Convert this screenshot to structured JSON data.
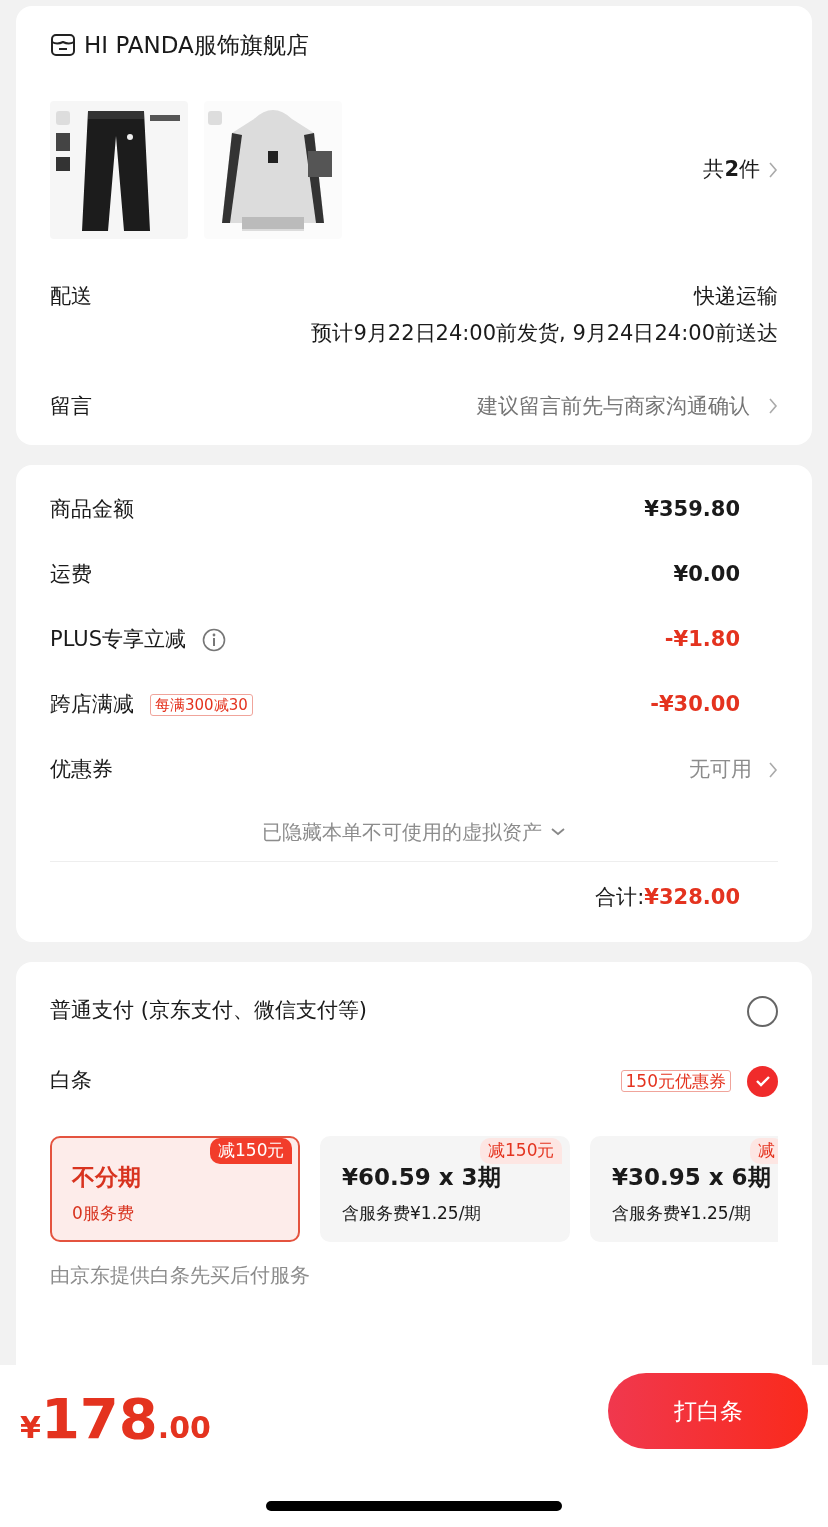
{
  "shop": {
    "name": "HI PANDA服饰旗舰店"
  },
  "item_count": "共**2**件",
  "delivery": {
    "label": "配送",
    "method": "快递运输",
    "estimate": "预计9月22日24:00前发货, 9月24日24:00前送达"
  },
  "message": {
    "label": "留言",
    "placeholder": "建议留言前先与商家沟通确认"
  },
  "price_rows": [
    {
      "kind": "amount",
      "label": "商品金额",
      "value": "¥359.80",
      "info": false
    },
    {
      "kind": "amount",
      "label": "运费",
      "value": "¥0.00",
      "info": false
    },
    {
      "kind": "discount",
      "label": "PLUS专享立减",
      "value": "-¥1.80",
      "info": true
    },
    {
      "kind": "discount",
      "label": "跨店满减",
      "tag": "每满300减30",
      "value": "-¥30.00",
      "info": false
    },
    {
      "kind": "link",
      "label": "优惠券",
      "value": "无可用",
      "info": false
    }
  ],
  "hidden_assets": "已隐藏本单不可使用的虚拟资产",
  "total": {
    "label": "合计:",
    "value": "¥328.00"
  },
  "payment_methods": [
    {
      "label": "普通支付 (京东支付、微信支付等)",
      "selected": false
    },
    {
      "label": "白条",
      "tag": "150元优惠券",
      "selected": true
    }
  ],
  "period_options": [
    {
      "title": "不分期",
      "subtitle": "0服务费",
      "badge": "减150元",
      "selected": true
    },
    {
      "title": "¥60.59 x 3期",
      "subtitle": "含服务费¥1.25/期",
      "badge": "减150元",
      "selected": false
    },
    {
      "title": "¥30.95 x 6期",
      "subtitle": "含服务费¥1.25/期",
      "badge": "减",
      "selected": false
    }
  ],
  "provider_note": "由京东提供白条先买后付服务",
  "bottom_bar": {
    "currency": "¥",
    "integer": "178",
    "decimal": ".00",
    "button": "打白条"
  }
}
